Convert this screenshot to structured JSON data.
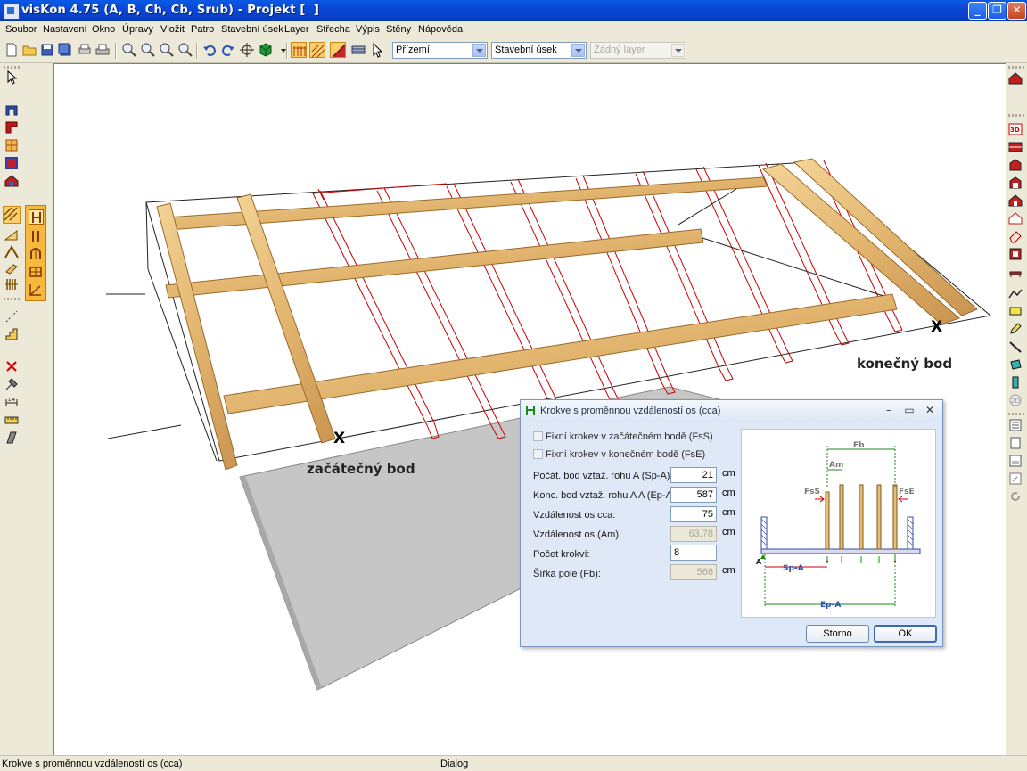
{
  "window": {
    "title": "visKon 4.75 (A, B, Ch, Cb, Srub) - Projekt [  ]"
  },
  "menu": [
    "Soubor",
    "Nastavení",
    "Okno",
    "Úpravy",
    "Vložit",
    "Patro",
    "Stavební úsek",
    "Layer",
    "Střecha",
    "Výpis",
    "Stěny",
    "Nápověda"
  ],
  "toolbar": {
    "floor_select": "Přízemí",
    "section_select": "Stavební úsek",
    "layer_select": "Žádný layer"
  },
  "scene": {
    "start_label": "začátečný bod",
    "end_label": "konečný bod",
    "start_marker": "X",
    "end_marker": "X"
  },
  "dialog": {
    "title": "Krokve s proměnnou vzdáleností os (cca)",
    "check_fixed_start": "Fixní krokev v začátečném bodě (FsS)",
    "check_fixed_end": "Fixní krokev v konečném bodě (FsE)",
    "fields": [
      {
        "label": "Počát. bod vztaž. rohu A (Sp-A):",
        "value": "21",
        "unit": "cm"
      },
      {
        "label": "Konc. bod vztaž. rohu A A (Ep-A):",
        "value": "587",
        "unit": "cm"
      },
      {
        "label": "Vzdálenost os cca:",
        "value": "75",
        "unit": "cm"
      },
      {
        "label": "Vzdálenost os (Am):",
        "value": "63,78",
        "unit": "cm"
      },
      {
        "label": "Počet krokví:",
        "value": "8",
        "unit": ""
      },
      {
        "label": "Šířka pole (Fb):",
        "value": "566",
        "unit": "cm"
      }
    ],
    "diagram_labels": {
      "fb": "Fb",
      "am": "Am",
      "fss": "FsS",
      "fse": "FsE",
      "a": "A",
      "spa": "Sp-A",
      "epa": "Ep-A"
    },
    "cancel_label": "Storno",
    "ok_label": "OK"
  },
  "status": {
    "left": "Krokve s proměnnou vzdáleností os (cca)",
    "center": "Dialog"
  },
  "colors": {
    "titlebar": "#0a48d6",
    "timber": "#e8bf7a",
    "rafter": "#cc0000",
    "active_tool": "#f6b93d"
  }
}
